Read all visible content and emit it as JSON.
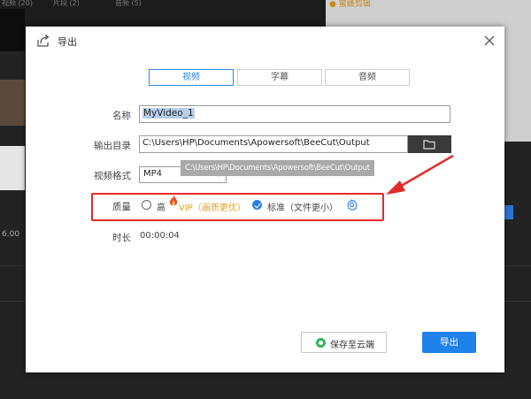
{
  "background": {
    "tabs": [
      "视频 (20)",
      "片段 (2)",
      "音频 (5)"
    ],
    "preview_title": "● 蜜蜂剪辑",
    "time_label": "6.00"
  },
  "dialog": {
    "title": "导出",
    "tabs": [
      {
        "label": "视频",
        "active": true
      },
      {
        "label": "字幕",
        "active": false
      },
      {
        "label": "音频",
        "active": false
      }
    ],
    "name_label": "名称",
    "name_value": "MyVideo_1",
    "output_label": "输出目录",
    "output_value": "C:\\Users\\HP\\Documents\\Apowersoft\\BeeCut\\Output",
    "output_tooltip": "C:\\Users\\HP\\Documents\\Apowersoft\\BeeCut\\Output",
    "format_label": "视频格式",
    "format_value": "MP4",
    "quality_label": "质量",
    "quality_high_label": "高",
    "quality_high_vip": "VIP（画质更优）",
    "quality_standard_label": "标准（文件更小）",
    "quality_selected": "standard",
    "duration_label": "时长",
    "duration_value": "00:00:04",
    "cloud_button_label": "保存至云端",
    "export_button_label": "导出"
  },
  "colors": {
    "accent": "#1f82e8",
    "highlight_box": "#e32b2b",
    "vip": "#e8a31c",
    "cloud_icon": "#2fb55a"
  }
}
